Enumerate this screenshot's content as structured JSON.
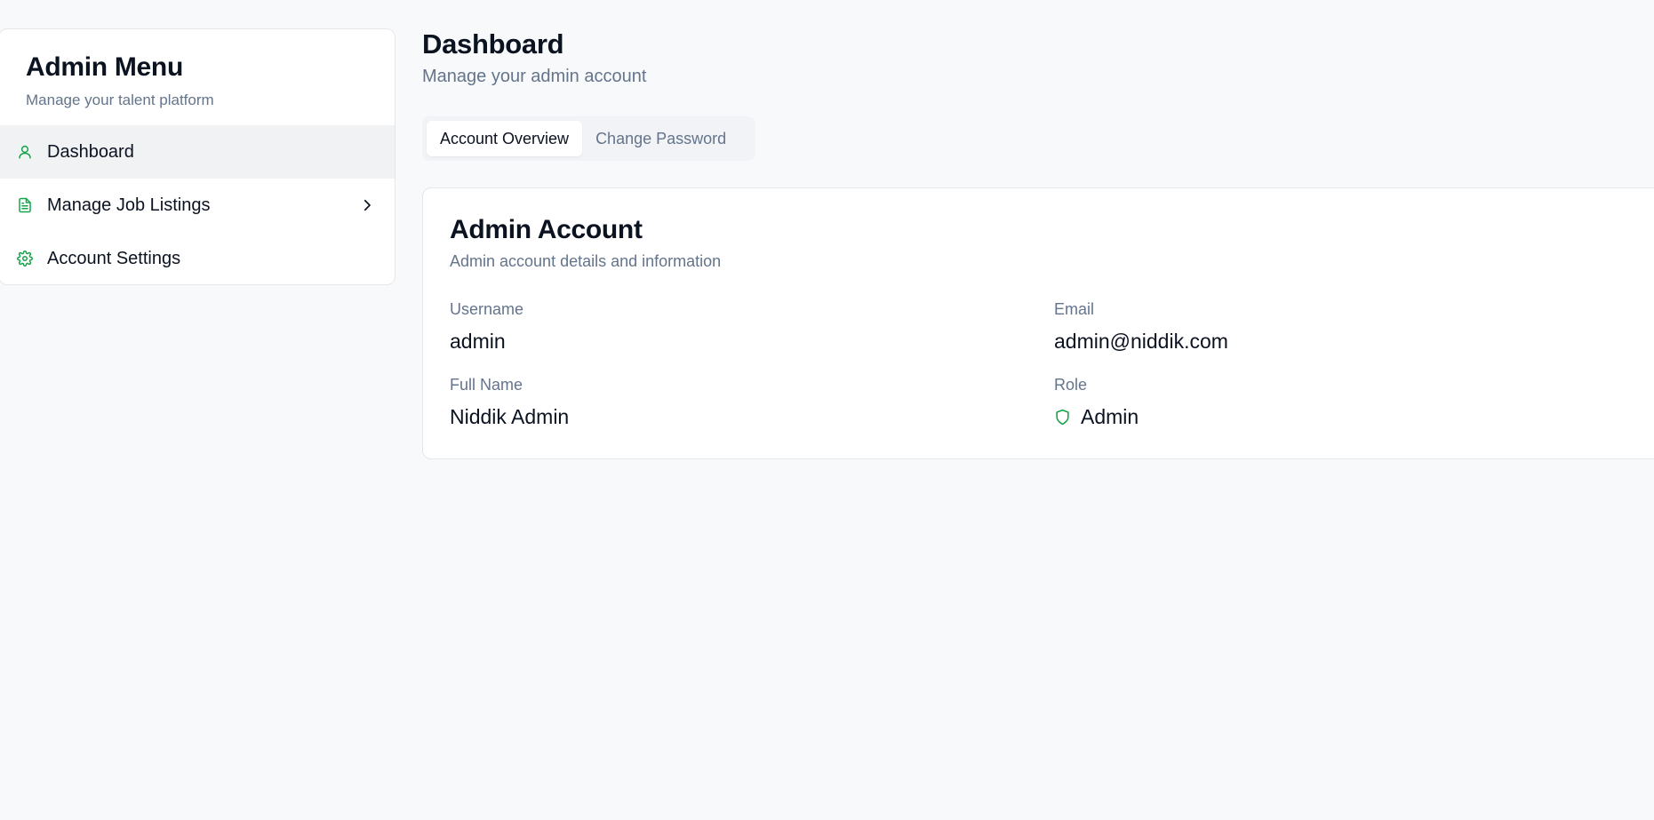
{
  "sidebar": {
    "title": "Admin Menu",
    "subtitle": "Manage your talent platform",
    "items": [
      {
        "label": "Dashboard",
        "icon": "user-icon",
        "active": true
      },
      {
        "label": "Manage Job Listings",
        "icon": "file-text-icon",
        "has_submenu": true
      },
      {
        "label": "Account Settings",
        "icon": "gear-icon"
      }
    ]
  },
  "header": {
    "title": "Dashboard",
    "subtitle": "Manage your admin account"
  },
  "tabs": [
    {
      "label": "Account Overview",
      "active": true
    },
    {
      "label": "Change Password",
      "active": false
    }
  ],
  "card": {
    "title": "Admin Account",
    "description": "Admin account details and information",
    "fields": {
      "username": {
        "label": "Username",
        "value": "admin"
      },
      "email": {
        "label": "Email",
        "value": "admin@niddik.com"
      },
      "full_name": {
        "label": "Full Name",
        "value": "Niddik Admin"
      },
      "role": {
        "label": "Role",
        "value": "Admin",
        "icon": "shield-icon"
      }
    }
  },
  "colors": {
    "accent": "#16a34a",
    "background": "#f8f9fb",
    "muted_text": "#64748b",
    "text": "#0b1220"
  }
}
